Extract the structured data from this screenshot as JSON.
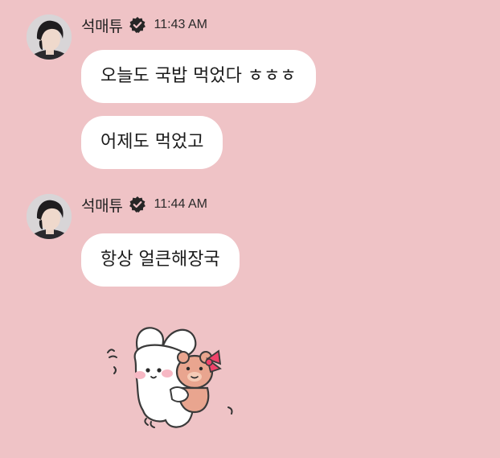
{
  "groups": [
    {
      "sender": "석매튜",
      "time": "11:43 AM",
      "messages": [
        "오늘도 국밥 먹었다 ㅎㅎㅎ",
        "어제도 먹었고"
      ]
    },
    {
      "sender": "석매튜",
      "time": "11:44 AM",
      "messages": [
        "항상 얼큰해장국"
      ]
    }
  ],
  "icons": {
    "verified": "verified-badge-icon",
    "sticker": "bunny-hugging-bear-sticker"
  },
  "colors": {
    "background": "#efc3c6",
    "bubble": "#ffffff",
    "text": "#1b1b1b"
  }
}
